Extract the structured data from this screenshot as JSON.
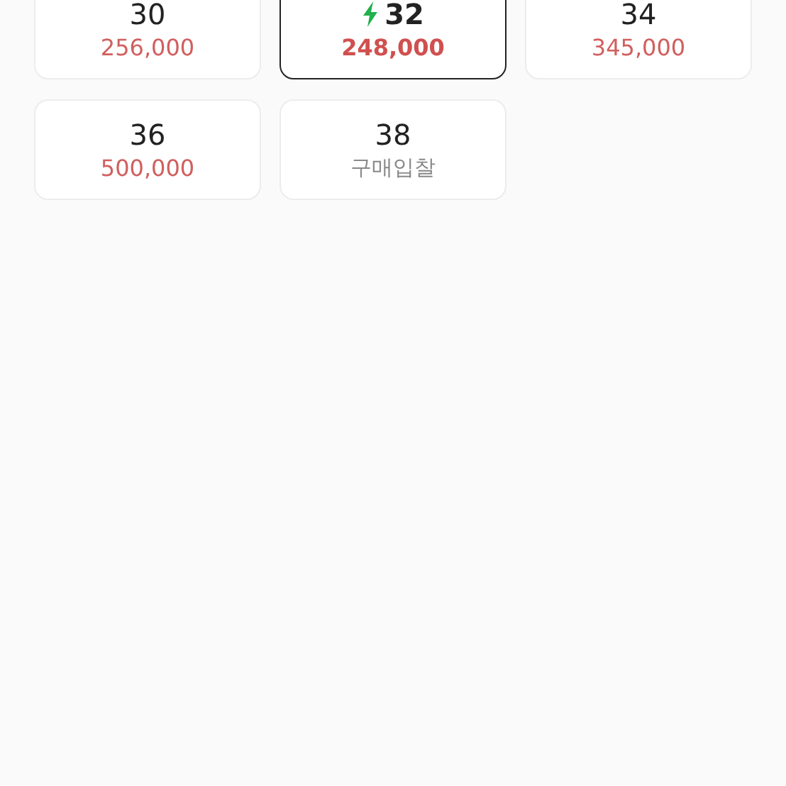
{
  "sizes": [
    {
      "size": "30",
      "price": "256,000",
      "kind": "price",
      "selected": false,
      "fast": false
    },
    {
      "size": "32",
      "price": "248,000",
      "kind": "price",
      "selected": true,
      "fast": true
    },
    {
      "size": "34",
      "price": "345,000",
      "kind": "price",
      "selected": false,
      "fast": false
    },
    {
      "size": "36",
      "price": "500,000",
      "kind": "price",
      "selected": false,
      "fast": false
    },
    {
      "size": "38",
      "price": "구매입찰",
      "kind": "bid",
      "selected": false,
      "fast": false
    }
  ]
}
